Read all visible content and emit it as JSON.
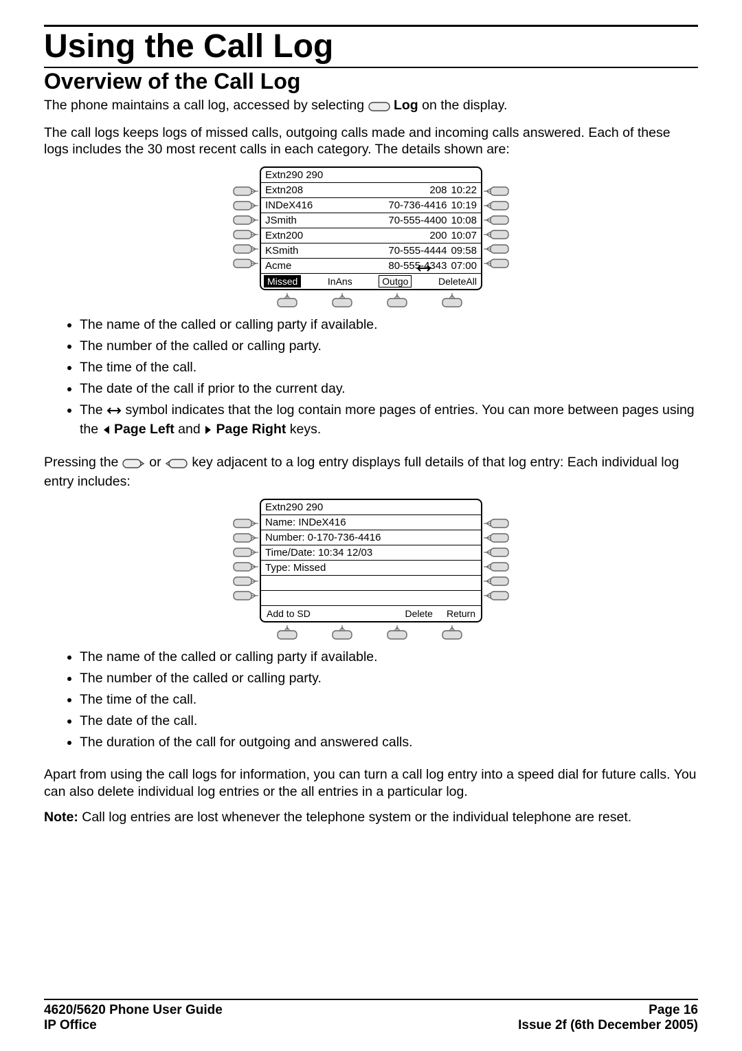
{
  "headings": {
    "h1": "Using the Call Log",
    "h2": "Overview of the Call Log"
  },
  "intro": {
    "p1a": "The phone maintains a call log, accessed by selecting ",
    "p1b": " Log",
    "p1c": " on the display.",
    "p2": "The call logs keeps logs of missed calls, outgoing calls made and incoming calls answered. Each of these logs includes the 30 most recent calls in each category. The details shown are:"
  },
  "fig1": {
    "header": "Extn290 290",
    "rows": [
      {
        "name": "Extn208",
        "num": "208",
        "time": "10:22"
      },
      {
        "name": "INDeX416",
        "num": "70-736-4416",
        "time": "10:19"
      },
      {
        "name": "JSmith",
        "num": "70-555-4400",
        "time": "10:08"
      },
      {
        "name": "Extn200",
        "num": "200",
        "time": "10:07"
      },
      {
        "name": "KSmith",
        "num": "70-555-4444",
        "time": "09:58"
      },
      {
        "name": "Acme",
        "num": "80-555-4343",
        "time": "07:00"
      }
    ],
    "tabs": {
      "missed": "Missed",
      "inans": "InAns",
      "outgo": "Outgo",
      "delall": "DeleteAll"
    }
  },
  "list1": {
    "b1": "The name of the called or calling party if available.",
    "b2": "The number of the called or calling party.",
    "b3": "The time of the call.",
    "b4": "The date of the call if prior to the current day.",
    "b5a": "The ",
    "b5b": " symbol indicates that the log contain more pages of entries. You can more between pages using the ",
    "b5c": " Page Left",
    "b5d": " and ",
    "b5e": " Page Right",
    "b5f": " keys."
  },
  "mid": {
    "p1a": "Pressing the ",
    "p1b": " or ",
    "p1c": " key adjacent to a log entry displays full details of that log entry: Each individual log entry includes:"
  },
  "fig2": {
    "header": "Extn290 290",
    "rows": [
      "Name: INDeX416",
      "Number: 0-170-736-4416",
      "Time/Date: 10:34  12/03",
      "Type: Missed"
    ],
    "tabs": {
      "add": "Add to SD",
      "del": "Delete",
      "ret": "Return"
    }
  },
  "list2": {
    "b1": "The name of the called or calling party if available.",
    "b2": "The number of the called or calling party.",
    "b3": "The time of the call.",
    "b4": "The date of the call.",
    "b5": "The duration of the call for outgoing and answered calls."
  },
  "closing": {
    "p1": "Apart from using the call logs for information, you can turn a call log entry into a speed dial for future calls. You can also delete individual log entries or the all entries in a particular log.",
    "noteLabel": "Note:",
    "noteText": " Call log entries are lost whenever the telephone system or the individual telephone are reset."
  },
  "footer": {
    "leftTop": "4620/5620 Phone User Guide",
    "rightTop": "Page 16",
    "leftBottom": "IP Office",
    "rightBottom": "Issue 2f (6th December 2005)"
  }
}
